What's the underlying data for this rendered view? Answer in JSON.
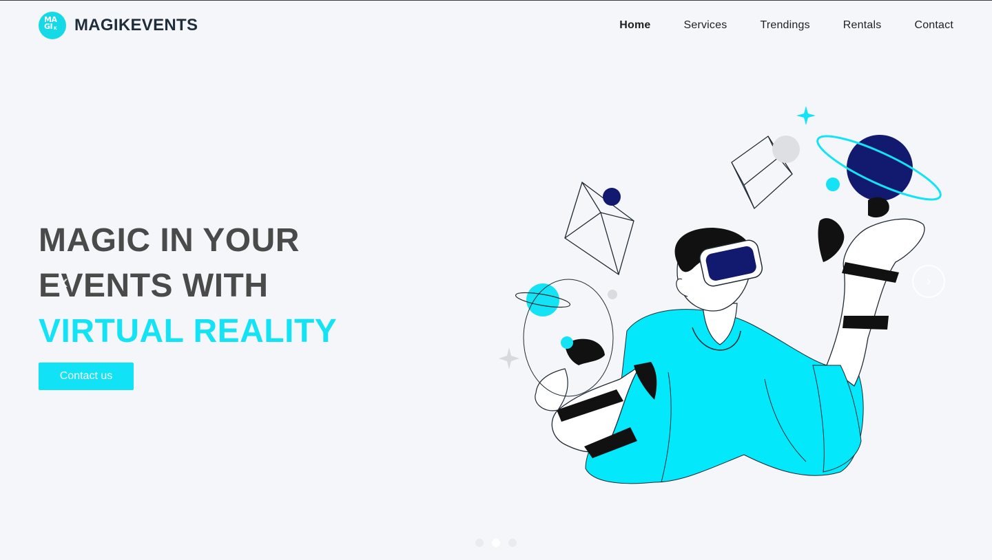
{
  "brand": {
    "logo_icon": "magikevents-logo-icon",
    "logo_mark_text": "MAGI",
    "name": "MAGIKEVENTS",
    "accent_color": "#14d9e6"
  },
  "nav": {
    "items": [
      {
        "label": "Home",
        "active": true
      },
      {
        "label": "Services",
        "active": false
      },
      {
        "label": "Trendings",
        "active": false
      },
      {
        "label": "Rentals",
        "active": false
      },
      {
        "label": "Contact",
        "active": false
      }
    ]
  },
  "hero": {
    "title_line1": "MAGIC IN YOUR",
    "title_line2": "EVENTS WITH",
    "title_line3": "VIRTUAL REALITY",
    "cta_label": "Contact us",
    "title_color": "#4a4a4a",
    "accent_color": "#14e3f5",
    "illustration": "vr-person-illustration"
  },
  "carousel": {
    "prev_icon": "chevron-left-icon",
    "next_icon": "chevron-right-icon",
    "slide_count": 3,
    "active_index": 1
  }
}
